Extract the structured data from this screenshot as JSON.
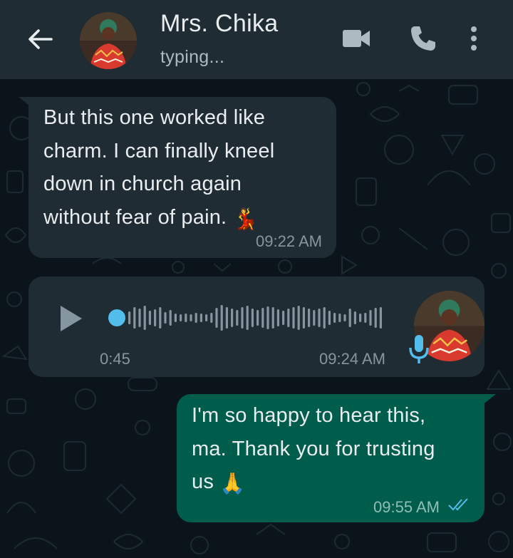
{
  "header": {
    "contact_name": "Mrs. Chika",
    "status": "typing..."
  },
  "icons": {
    "back": "arrow-left-icon",
    "video": "video-camera-icon",
    "call": "phone-icon",
    "menu": "more-vert-icon",
    "play": "play-icon",
    "mic": "microphone-icon",
    "read_receipt": "double-check-icon"
  },
  "colors": {
    "header_bg": "#1f2c34",
    "chat_bg": "#0b141a",
    "incoming_bubble": "#202c33",
    "outgoing_bubble": "#005c4b",
    "audio_accent": "#53bdeb",
    "read_tick": "#53bdeb"
  },
  "messages": [
    {
      "direction": "incoming",
      "type": "text",
      "lines": [
        "But this one worked like",
        "charm. I can finally kneel",
        "down in church again",
        "without fear of pain."
      ],
      "emoji": "💃",
      "time": "09:22 AM"
    },
    {
      "direction": "incoming",
      "type": "voice",
      "duration": "0:45",
      "time": "09:24 AM",
      "progress": 0
    },
    {
      "direction": "outgoing",
      "type": "text",
      "lines": [
        "I'm so happy to hear this,",
        "ma. Thank you for trusting",
        "us"
      ],
      "emoji": "🙏",
      "time": "09:55 AM",
      "status": "read"
    }
  ]
}
